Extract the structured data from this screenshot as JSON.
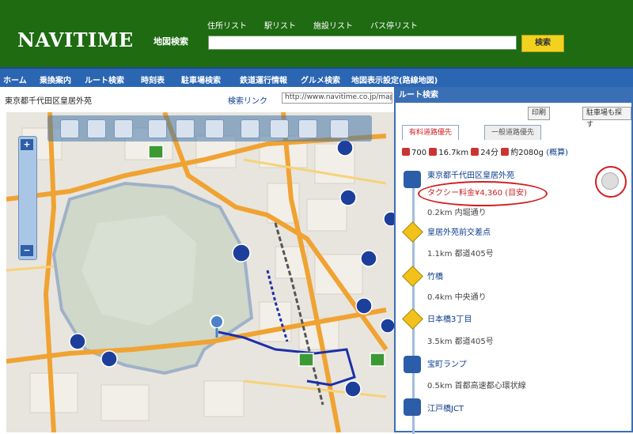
{
  "header": {
    "logo": "NAVITIME",
    "top_links": [
      "住所リスト",
      "駅リスト",
      "施設リスト",
      "バス停リスト"
    ],
    "search_label": "地図検索",
    "search_value": "",
    "search_button": "検索"
  },
  "nav": {
    "items": [
      "ホーム",
      "乗換案内",
      "ルート検索",
      "時刻表",
      "駐車場検索",
      "鉄道運行情報",
      "グルメ検索",
      "地図表示設定(路線地図)"
    ]
  },
  "address_bar": {
    "address": "東京都千代田区皇居外苑",
    "search_link": "検索リンク",
    "url": "http://www.navitime.co.jp/maps"
  },
  "route_panel": {
    "title": "ルート検索",
    "buttons": [
      "印刷",
      "駐車場も探す"
    ],
    "tabs": [
      "有料道路優先",
      "一般道路優先"
    ],
    "summary": {
      "toll": "700",
      "distance": "16.7km",
      "time": "24分",
      "fuel": "約2080g",
      "note": "(概算)"
    },
    "steps": [
      {
        "name": "東京都千代田区皇居外苑",
        "sub": "タクシー料金¥4,360 (目安)"
      },
      {
        "segment": "0.2km 内堀通り"
      },
      {
        "name": "皇居外苑前交差点"
      },
      {
        "segment": "1.1km 都道405号"
      },
      {
        "name": "竹橋"
      },
      {
        "segment": "0.4km 中央通り"
      },
      {
        "name": "日本橋3丁目"
      },
      {
        "segment": "3.5km 都道405号"
      },
      {
        "name": "宝町ランプ"
      },
      {
        "segment": "0.5km 首都高速都心環状線"
      },
      {
        "name": "江戸橋JCT"
      }
    ]
  },
  "colors": {
    "header_bg": "#1e6b12",
    "nav_bg": "#2b66b3",
    "accent_red": "#d21e1e",
    "route_blue": "#1d2fa8"
  }
}
